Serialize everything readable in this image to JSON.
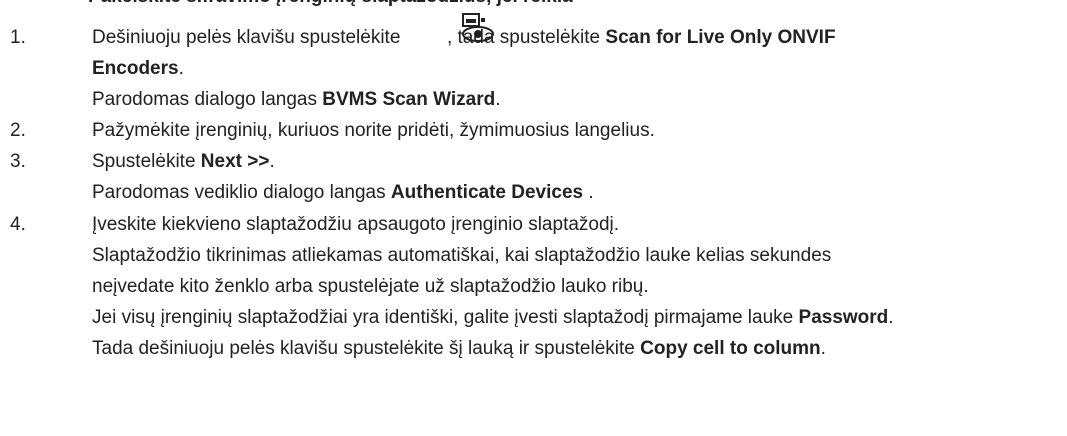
{
  "heading_cut": "Pakeiskite šifravimo įrenginių slaptažodžius, jei reikia",
  "steps": [
    {
      "num": "1.",
      "l1a": "Dešiniuoju pelės klavišu spustelėkite ",
      "l1b": " , tada spustelėkite ",
      "l1c": "Scan for Live Only ONVIF",
      "l2": "Encoders",
      "l2b": ".",
      "r1a": "Parodomas dialogo langas ",
      "r1b": "BVMS Scan Wizard",
      "r1c": "."
    },
    {
      "num": "2.",
      "text": "Pažymėkite įrenginių, kuriuos norite pridėti, žymimuosius langelius."
    },
    {
      "num": "3.",
      "l1a": "Spustelėkite ",
      "l1b": "Next >>",
      "l1c": ".",
      "r1a": "Parodomas vediklio dialogo langas ",
      "r1b": "Authenticate Devices",
      "r1c": " ."
    },
    {
      "num": "4.",
      "text": "Įveskite kiekvieno slaptažodžiu apsaugoto įrenginio slaptažodį.",
      "r1": "Slaptažodžio tikrinimas atliekamas automatiškai, kai slaptažodžio lauke kelias sekundes",
      "r2": "neįvedate kito ženklo arba spustelėjate už slaptažodžio lauko ribų.",
      "r3a": "Jei visų įrenginių slaptažodžiai yra identiški, galite įvesti slaptažodį pirmajame lauke ",
      "r3b": "Password",
      "r3c": ".",
      "r4a": "Tada dešiniuoju pelės klavišu spustelėkite šį lauką ir spustelėkite ",
      "r4b": "Copy cell to column",
      "r4c": "."
    }
  ],
  "icon": "live-only-onvif-encoder-icon"
}
